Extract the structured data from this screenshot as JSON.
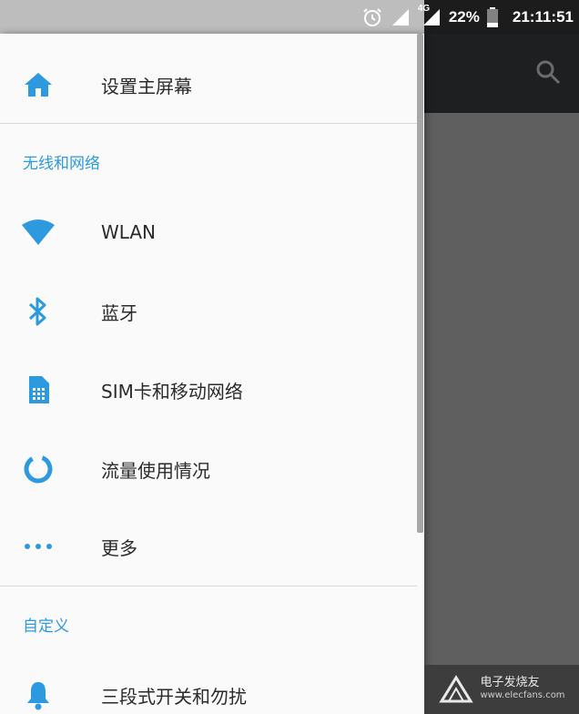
{
  "status_bar": {
    "network": "4G",
    "battery": "22%",
    "time": "21:11:51",
    "icons": [
      "alarm-icon",
      "signal-icon",
      "signal-4g-icon",
      "battery-icon"
    ]
  },
  "colors": {
    "accent": "#2d9ae0",
    "drawer_bg": "#fafafa",
    "scrim": "#5f5f5f",
    "appbar": "#1d1f21"
  },
  "drawer": {
    "home_item": {
      "label": "设置主屏幕",
      "icon": "home-icon"
    },
    "sections": [
      {
        "header": "无线和网络",
        "items": [
          {
            "label": "WLAN",
            "icon": "wifi-icon"
          },
          {
            "label": "蓝牙",
            "icon": "bluetooth-icon"
          },
          {
            "label": "SIM卡和移动网络",
            "icon": "sim-card-icon"
          },
          {
            "label": "流量使用情况",
            "icon": "data-usage-icon"
          },
          {
            "label": "更多",
            "icon": "more-dots-icon"
          }
        ]
      },
      {
        "header": "自定义",
        "items": [
          {
            "label": "三段式开关和勿扰",
            "icon": "bell-icon"
          }
        ]
      }
    ]
  },
  "appbar": {
    "icon": "search-icon"
  },
  "watermark": {
    "title": "电子发烧友",
    "url": "www.elecfans.com"
  }
}
